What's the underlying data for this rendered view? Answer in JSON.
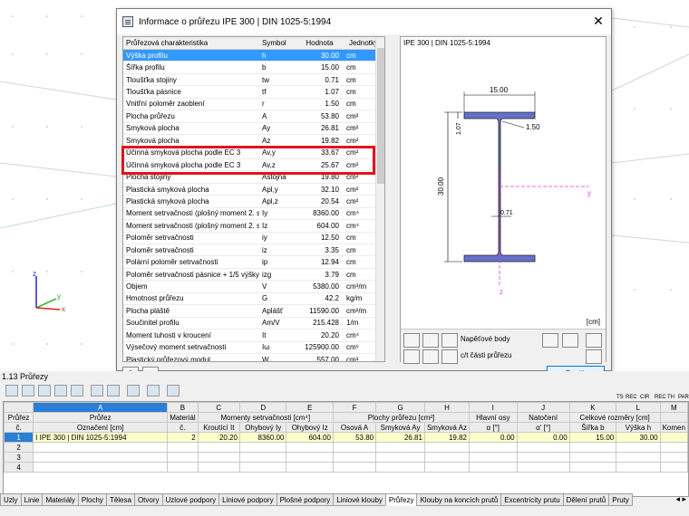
{
  "dialog": {
    "title": "Informace o průřezu IPE 300 | DIN 1025-5:1994",
    "close_glyph": "✕",
    "columns": [
      "Průřezová charakteristika",
      "Symbol",
      "Hodnota",
      "Jednotky"
    ],
    "rows": [
      {
        "name": "Výška profilu",
        "sym": "h",
        "val": "30.00",
        "unit": "cm",
        "selected": true
      },
      {
        "name": "Šířka profilu",
        "sym": "b",
        "val": "15.00",
        "unit": "cm"
      },
      {
        "name": "Tloušťka stojiny",
        "sym": "tw",
        "val": "0.71",
        "unit": "cm"
      },
      {
        "name": "Tloušťka pásnice",
        "sym": "tf",
        "val": "1.07",
        "unit": "cm"
      },
      {
        "name": "Vnitřní poloměr zaoblení",
        "sym": "r",
        "val": "1.50",
        "unit": "cm"
      },
      {
        "name": "Plocha průřezu",
        "sym": "A",
        "val": "53.80",
        "unit": "cm²"
      },
      {
        "name": "Smyková plocha",
        "sym": "Ay",
        "val": "26.81",
        "unit": "cm²"
      },
      {
        "name": "Smyková plocha",
        "sym": "Az",
        "val": "19.82",
        "unit": "cm²"
      },
      {
        "name": "Účinná smyková plocha podle EC 3",
        "sym": "Av,y",
        "val": "33.67",
        "unit": "cm²"
      },
      {
        "name": "Účinná smyková plocha podle EC 3",
        "sym": "Av,z",
        "val": "25.67",
        "unit": "cm²"
      },
      {
        "name": "Plocha stojiny",
        "sym": "Astojna",
        "val": "19.80",
        "unit": "cm²"
      },
      {
        "name": "Plastická smyková plocha",
        "sym": "Apl,y",
        "val": "32.10",
        "unit": "cm²"
      },
      {
        "name": "Plastická smyková plocha",
        "sym": "Apl,z",
        "val": "20.54",
        "unit": "cm²"
      },
      {
        "name": "Moment setrvačnosti (plošný moment 2. st",
        "sym": "Iy",
        "val": "8360.00",
        "unit": "cm⁴"
      },
      {
        "name": "Moment setrvačnosti (plošný moment 2. st",
        "sym": "Iz",
        "val": "604.00",
        "unit": "cm⁴"
      },
      {
        "name": "Poloměr setrvačnosti",
        "sym": "iy",
        "val": "12.50",
        "unit": "cm"
      },
      {
        "name": "Poloměr setrvačnosti",
        "sym": "iz",
        "val": "3.35",
        "unit": "cm"
      },
      {
        "name": "Polární poloměr setrvačnosti",
        "sym": "ip",
        "val": "12.94",
        "unit": "cm"
      },
      {
        "name": "Poloměr setrvačnosti pásnice + 1/5 výšky",
        "sym": "izg",
        "val": "3.79",
        "unit": "cm"
      },
      {
        "name": "Objem",
        "sym": "V",
        "val": "5380.00",
        "unit": "cm³/m"
      },
      {
        "name": "Hmotnost průřezu",
        "sym": "G",
        "val": "42.2",
        "unit": "kg/m"
      },
      {
        "name": "Plocha pláště",
        "sym": "Aplášť",
        "val": "11590.00",
        "unit": "cm²/m"
      },
      {
        "name": "Součinitel profilu",
        "sym": "Am/V",
        "val": "215.428",
        "unit": "1/m"
      },
      {
        "name": "Moment tuhosti v kroucení",
        "sym": "It",
        "val": "20.20",
        "unit": "cm⁴"
      },
      {
        "name": "Výsečový moment setrvačnosti",
        "sym": "Iω",
        "val": "125900.00",
        "unit": "cm⁶"
      },
      {
        "name": "Plastický průřezový modul",
        "sym": "W",
        "val": "557.00",
        "unit": "cm³"
      }
    ],
    "section": {
      "title": "IPE 300 | DIN 1025-5:1994",
      "dim_b": "15.00",
      "dim_h": "30.00",
      "dim_tf": "1.07",
      "dim_r": "1.50",
      "dim_tw": "0.71",
      "axis_y": "y",
      "axis_z": "z",
      "unit": "[cm]",
      "opt_stress": "Napěťové body",
      "opt_ct": "c/t části průřezu"
    },
    "close_button": "Zavřít",
    "help_glyph": "?"
  },
  "axes": {
    "x": "x",
    "y": "y",
    "z": "z"
  },
  "panel": {
    "title": "1.13 Průřezy",
    "toolbar_labels": [
      "TS",
      "REC",
      "CIR",
      "REC",
      "TH",
      "PAR"
    ],
    "col_letters": [
      "A",
      "B",
      "C",
      "D",
      "E",
      "F",
      "G",
      "H",
      "I",
      "J",
      "K",
      "L",
      "M"
    ],
    "head1": {
      "rownum": "Průřez",
      "a": "Průřez",
      "b": "Materiál",
      "moments": "Momenty setrvačnosti [cm⁴]",
      "areas": "Plochy průřezu [cm²]",
      "axis": "Hlavní osy",
      "rot": "Natočení",
      "dims": "Celkové rozměry [cm]",
      "m": ""
    },
    "head2": {
      "rownum": "č.",
      "a": "Označení [cm]",
      "b": "č.",
      "c": "Kroutící It",
      "d": "Ohybový Iy",
      "e": "Ohybový Iz",
      "f": "Osová A",
      "g": "Smyková Ay",
      "h": "Smyková Az",
      "i": "α [°]",
      "j": "α' [°]",
      "k": "Šířka b",
      "l": "Výška h",
      "m": "Komen"
    },
    "rows": [
      {
        "n": "1",
        "name": "I IPE 300 | DIN 1025-5:1994",
        "mat": "2",
        "it": "20.20",
        "iy": "8360.00",
        "iz": "604.00",
        "a": "53.80",
        "ay": "26.81",
        "az": "19.82",
        "alpha": "0.00",
        "alpha2": "0.00",
        "b": "15.00",
        "h": "30.00",
        "kom": ""
      },
      {
        "n": "2",
        "name": "",
        "mat": "",
        "it": "",
        "iy": "",
        "iz": "",
        "a": "",
        "ay": "",
        "az": "",
        "alpha": "",
        "alpha2": "",
        "b": "",
        "h": "",
        "kom": ""
      },
      {
        "n": "3",
        "name": "",
        "mat": "",
        "it": "",
        "iy": "",
        "iz": "",
        "a": "",
        "ay": "",
        "az": "",
        "alpha": "",
        "alpha2": "",
        "b": "",
        "h": "",
        "kom": ""
      },
      {
        "n": "4",
        "name": "",
        "mat": "",
        "it": "",
        "iy": "",
        "iz": "",
        "a": "",
        "ay": "",
        "az": "",
        "alpha": "",
        "alpha2": "",
        "b": "",
        "h": "",
        "kom": ""
      }
    ],
    "tabs": [
      "Uzly",
      "Linie",
      "Materiály",
      "Plochy",
      "Tělesa",
      "Otvory",
      "Uzlové podpory",
      "Liniové podpory",
      "Plošné podpory",
      "Liniové klouby",
      "Průřezy",
      "Klouby na koncích prutů",
      "Excentricity prutu",
      "Dělení prutů",
      "Pruty"
    ],
    "active_tab": "Průřezy",
    "tab_arrows": "◂ ▸"
  },
  "colors": {
    "accent": "#3399ff",
    "highlight": "#e0141e",
    "section_fill": "#6670c8",
    "axis_pink": "#e040e0"
  }
}
